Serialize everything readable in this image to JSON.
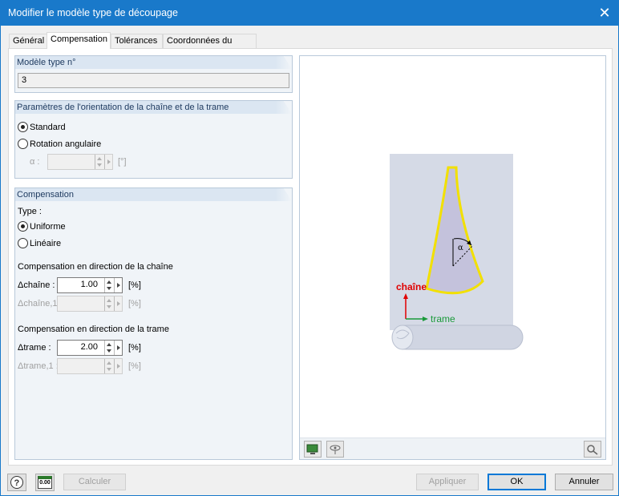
{
  "window": {
    "title": "Modifier le modèle type de découpage",
    "close_glyph": "✕"
  },
  "tabs": [
    {
      "label": "Général"
    },
    {
      "label": "Compensation"
    },
    {
      "label": "Tolérances"
    },
    {
      "label": "Coordonnées du point"
    }
  ],
  "model_group": {
    "title": "Modèle type n°",
    "value": "3"
  },
  "orientation_group": {
    "title": "Paramètres de l'orientation de la chaîne et de la trame",
    "options": [
      "Standard",
      "Rotation angulaire"
    ],
    "selected": "Standard",
    "alpha_label": "α :",
    "alpha_value": "",
    "alpha_unit": "[°]"
  },
  "compensation_group": {
    "title": "Compensation",
    "type_label": "Type :",
    "type_options": [
      "Uniforme",
      "Linéaire"
    ],
    "type_selected": "Uniforme",
    "chain_heading": "Compensation en direction de la chaîne",
    "chain_delta_label": "Δchaîne :",
    "chain_delta_value": "1.00",
    "chain_delta_unit": "[%]",
    "chain_delta1_label": "Δchaîne,1 :",
    "chain_delta1_value": "",
    "chain_delta1_unit": "[%]",
    "weft_heading": "Compensation en direction de la trame",
    "weft_delta_label": "Δtrame :",
    "weft_delta_value": "2.00",
    "weft_delta_unit": "[%]",
    "weft_delta1_label": "Δtrame,1 :",
    "weft_delta1_value": "",
    "weft_delta1_unit": "[%]"
  },
  "preview": {
    "chain_label": "chaîne",
    "weft_label": "trame",
    "alpha_label": "α",
    "colors": {
      "chain": "#e00000",
      "weft": "#1a9a3a",
      "outline": "#f2e000",
      "fabric": "#d5dae6"
    }
  },
  "footer": {
    "calc_label": "Calculer",
    "apply_label": "Appliquer",
    "ok_label": "OK",
    "cancel_label": "Annuler",
    "units_icon_text": "0.00"
  }
}
